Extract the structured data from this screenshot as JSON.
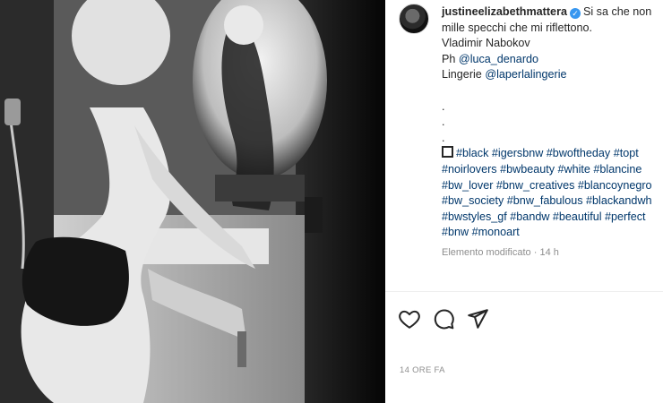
{
  "post": {
    "username": "justineelizabethmattera",
    "verified_icon": "verified-badge-icon",
    "caption_lines": [
      "Si sa che non",
      "mille specchi che mi riflettono.",
      "Vladimir Nabokov"
    ],
    "photo_credit_prefix": "Ph",
    "photo_credit_mention": "@luca_denardo",
    "lingerie_prefix": "Lingerie",
    "lingerie_mention": "@laperlalingerie",
    "dots": [
      ".",
      ".",
      "."
    ],
    "square_icon": "black-square-icon",
    "hashtag_lines": [
      "#black #igersbnw #bwoftheday #topt",
      "#noirlovers #bwbeauty #white #blancine",
      "#bw_lover #bnw_creatives #blancoynegro",
      "#bw_society #bnw_fabulous #blackandwh",
      "#bwstyles_gf #bandw #beautiful #perfect",
      "#bnw #monoart"
    ],
    "edited_label": "Elemento modificato",
    "separator": "·",
    "edited_time": "14 h",
    "time_ago": "14 ORE FA"
  },
  "actions": {
    "like_icon": "heart-icon",
    "comment_icon": "comment-icon",
    "share_icon": "share-icon"
  },
  "colors": {
    "link": "#00376b",
    "muted": "#8e8e8e",
    "text": "#262626",
    "verified": "#3897f0"
  }
}
